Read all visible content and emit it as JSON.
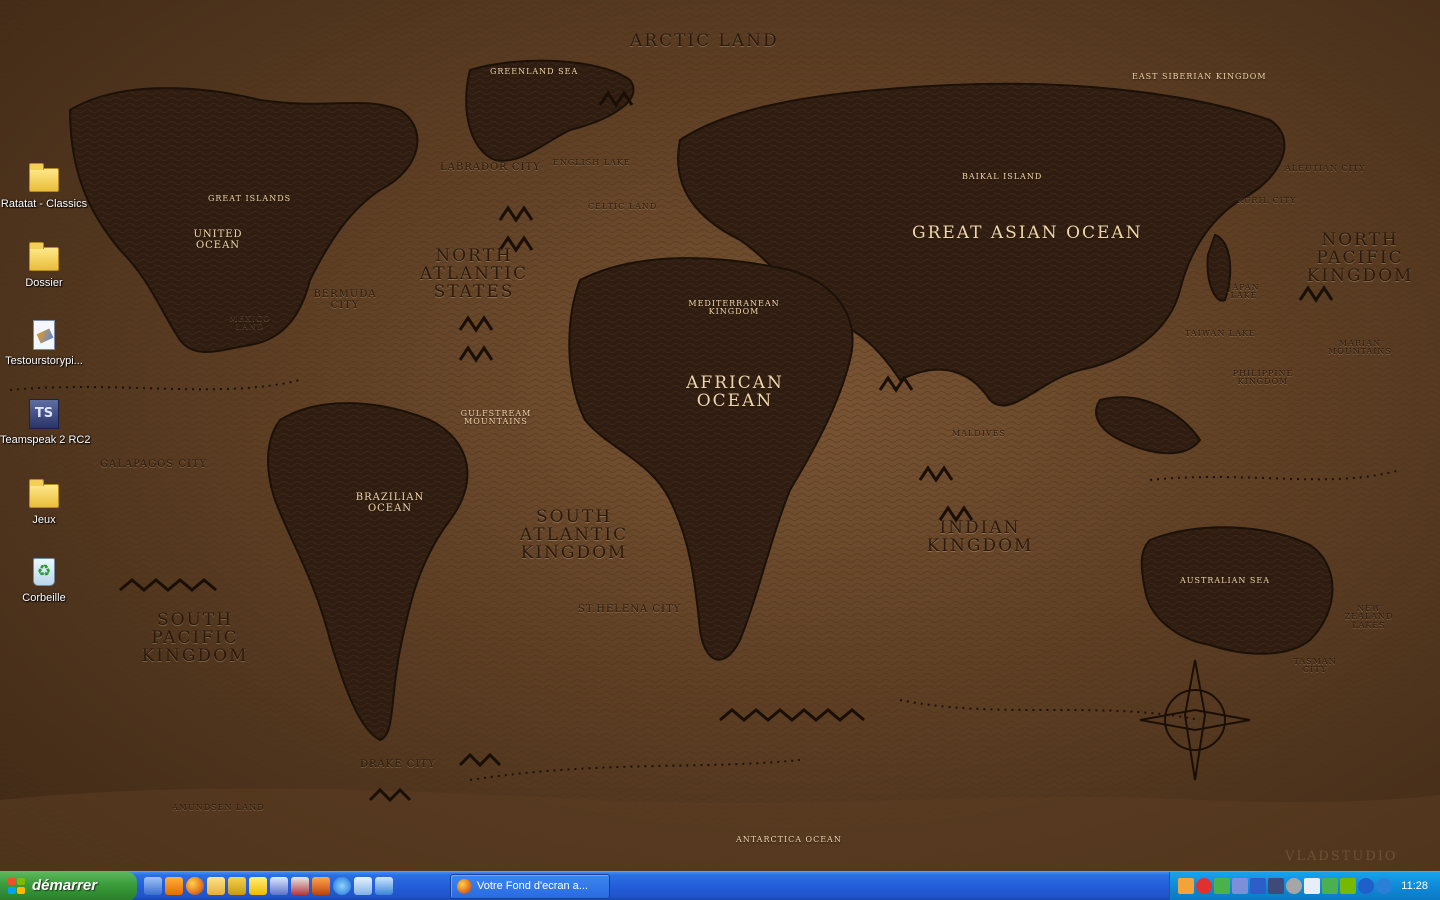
{
  "wallpaper": {
    "labels": {
      "arctic_land": "ARCTIC LAND",
      "greenland_sea": "GREENLAND SEA",
      "east_siberian_kingdom": "EAST SIBERIAN KINGDOM",
      "labrador_city": "LABRADOR CITY",
      "english_lake": "ENGLISH LAKE",
      "celtic_land": "CELTIC LAND",
      "baikal_island": "BAIKAL ISLAND",
      "aleutian_city": "ALEUTIAN CITY",
      "kuril_city": "KURIL CITY",
      "great_islands": "GREAT ISLANDS",
      "united_ocean": "UNITED OCEAN",
      "north_atlantic_states": "NORTH ATLANTIC STATES",
      "great_asian_ocean": "GREAT ASIAN OCEAN",
      "north_pacific_kingdom": "NORTH PACIFIC KINGDOM",
      "bermuda_city": "BERMUDA CITY",
      "mexico_land": "MEXICO LAND",
      "mediterranean_kingdom": "MEDITERRANEAN KINGDOM",
      "japan_lake": "JAPAN LAKE",
      "taiwan_lake": "TAIWAN LAKE",
      "marian_mountains": "MARIAN MOUNTAINS",
      "philippine_kingdom": "PHILIPPINE KINGDOM",
      "african_ocean": "AFRICAN OCEAN",
      "gulfstream_mountains": "GULFSTREAM MOUNTAINS",
      "maldives": "MALDIVES",
      "galapagos_city": "GALAPAGOS CITY",
      "brazilian_ocean": "BRAZILIAN OCEAN",
      "south_atlantic_kingdom": "SOUTH ATLANTIC KINGDOM",
      "indian_kingdom": "INDIAN KINGDOM",
      "australian_sea": "AUSTRALIAN SEA",
      "st_helena_city": "ST.HELENA CITY",
      "south_pacific_kingdom": "SOUTH PACIFIC KINGDOM",
      "new_zealand_lakes": "NEW ZEALAND LAKES",
      "tasman_city": "TASMAN CITY",
      "drake_city": "DRAKE CITY",
      "amundsen_land": "AMUNDSEN LAND",
      "antarctica_ocean": "ANTARCTICA OCEAN",
      "vladstudio": "VLADSTUDIO"
    },
    "colors": {
      "land": "#2e1d10",
      "ocean": "#7a5534",
      "label_light": "#f0d6ae"
    }
  },
  "desktop_icons": [
    {
      "label": "Ratatat - Classics",
      "icon": "folder-icon"
    },
    {
      "label": "Dossier",
      "icon": "folder-icon"
    },
    {
      "label": "Testourstorypi...",
      "icon": "document-icon"
    },
    {
      "label": "Teamspeak 2 RC2",
      "icon": "teamspeak-icon",
      "glyph": "TS"
    },
    {
      "label": "Jeux",
      "icon": "folder-icon"
    },
    {
      "label": "Corbeille",
      "icon": "recycle-bin-icon"
    }
  ],
  "taskbar": {
    "start_label": "démarrer",
    "quick_launch": [
      "show-desktop-icon",
      "vlc-icon",
      "firefox-icon",
      "explorer-icon",
      "winamp-icon",
      "utility-icon",
      "editor-icon",
      "media-icon",
      "game-icon",
      "ie-icon",
      "itunes-icon",
      "network-icon"
    ],
    "window_button": "Votre Fond d'ecran a...",
    "tray_icons": [
      "antivirus-icon",
      "block-icon",
      "messenger-icon",
      "network-icon",
      "bluetooth-icon",
      "teamspeak-icon",
      "settings-icon",
      "monitor-icon",
      "safely-remove-icon",
      "nvidia-icon",
      "info-icon",
      "update-icon"
    ],
    "clock": "11:28",
    "colors": {
      "bar": "#245edb",
      "start": "#3c9d3c",
      "tray": "#0f8ad7"
    }
  }
}
